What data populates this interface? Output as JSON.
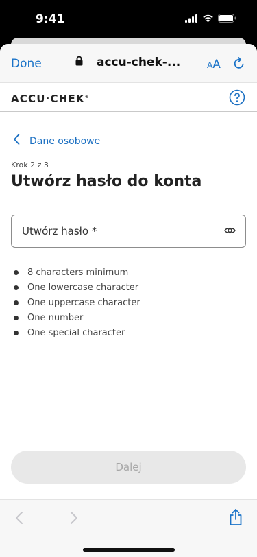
{
  "status_bar": {
    "time": "9:41"
  },
  "safari": {
    "done_label": "Done",
    "url": "accu-chek-...",
    "text_size_small": "A",
    "text_size_large": "A"
  },
  "site": {
    "logo_text": "ACCU·CHEK",
    "logo_mark": "®"
  },
  "breadcrumb": {
    "label": "Dane osobowe"
  },
  "step": {
    "text": "Krok 2 z 3"
  },
  "page_title": "Utwórz hasło do konta",
  "password": {
    "placeholder": "Utwórz hasło *"
  },
  "requirements": [
    "8 characters minimum",
    "One lowercase character",
    "One uppercase character",
    "One number",
    "One special character"
  ],
  "next_button": {
    "label": "Dalej",
    "state": "disabled"
  },
  "colors": {
    "accent": "#1a73c8",
    "disabled_bg": "#e8e8e8",
    "disabled_text": "#a7a7a7"
  },
  "icons": {
    "lock": "lock-icon",
    "reload": "reload-icon",
    "help": "help-circle-icon",
    "back": "chevron-left-icon",
    "eye": "eye-icon",
    "share": "share-icon"
  }
}
